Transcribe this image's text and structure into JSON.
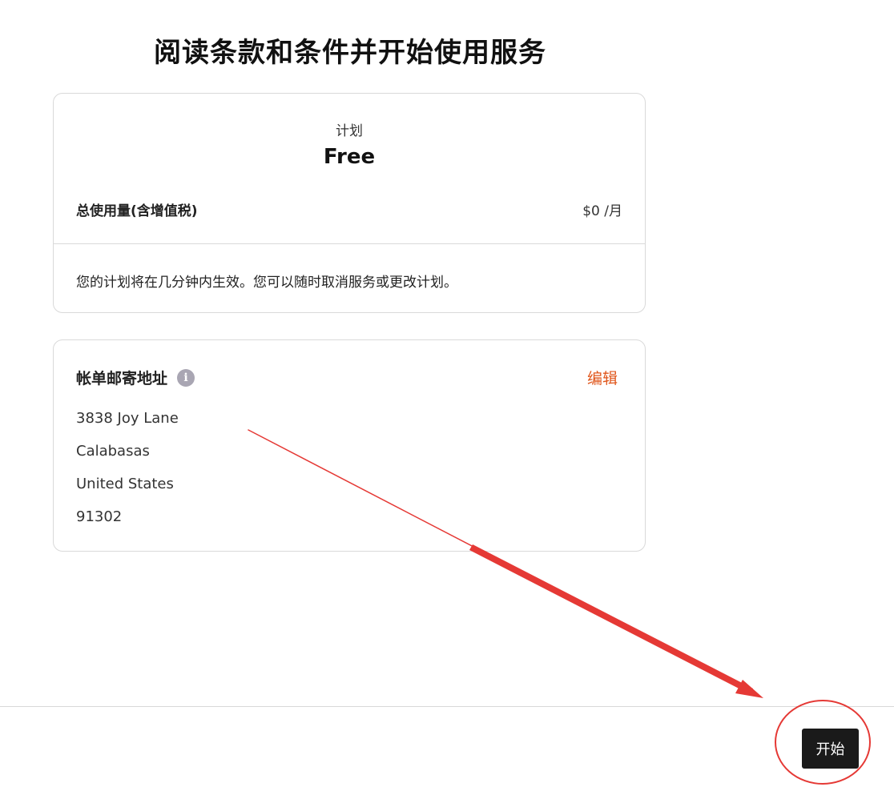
{
  "header": {
    "title": "阅读条款和条件并开始使用服务"
  },
  "plan": {
    "label": "计划",
    "name": "Free",
    "usage_label": "总使用量(含增值税)",
    "usage_value": "$0 /月",
    "note": "您的计划将在几分钟内生效。您可以随时取消服务或更改计划。"
  },
  "billing_address": {
    "title": "帐单邮寄地址",
    "info_icon": "info-icon",
    "edit_label": "编辑",
    "lines": [
      "3838 Joy Lane",
      "Calabasas",
      "United States",
      "91302"
    ]
  },
  "footer": {
    "start_label": "开始"
  },
  "colors": {
    "accent_link": "#e0561b",
    "button_bg": "#1a1a1a",
    "annotation_red": "#e53935"
  }
}
